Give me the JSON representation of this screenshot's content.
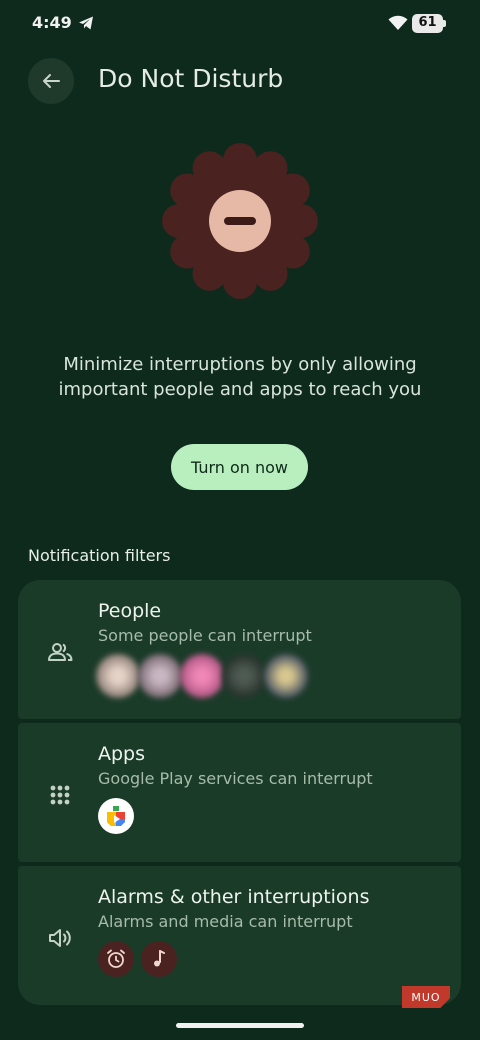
{
  "status_bar": {
    "time": "4:49",
    "battery": "61"
  },
  "header": {
    "title": "Do Not Disturb"
  },
  "hero": {
    "description_line1": "Minimize interruptions by only allowing",
    "description_line2": "important people and apps to reach you",
    "button_label": "Turn on now"
  },
  "section": {
    "title": "Notification filters"
  },
  "filters": [
    {
      "title": "People",
      "subtitle": "Some people can interrupt",
      "icon": "people-icon"
    },
    {
      "title": "Apps",
      "subtitle": "Google Play services can interrupt",
      "icon": "apps-grid-icon"
    },
    {
      "title": "Alarms & other interruptions",
      "subtitle": "Alarms and media can interrupt",
      "icon": "volume-icon"
    }
  ],
  "watermark": "MUO",
  "colors": {
    "background": "#0d2a1c",
    "card": "#1b3b29",
    "primary_button": "#b9efbf",
    "hero_badge": "#4a2220",
    "hero_minus_circle": "#e6b9a6"
  }
}
